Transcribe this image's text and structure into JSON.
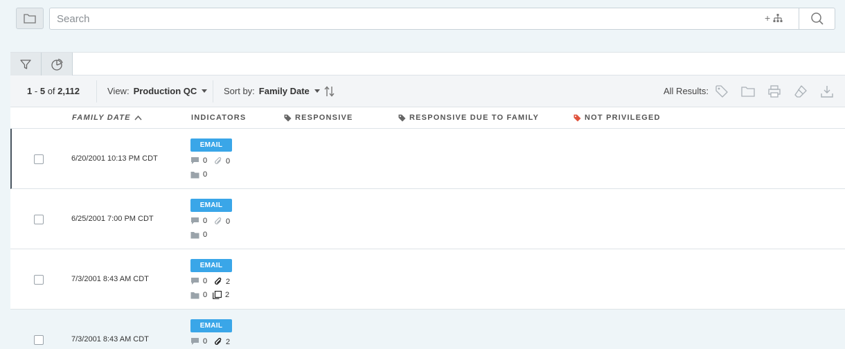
{
  "search": {
    "placeholder": "Search",
    "plus": "+"
  },
  "toolbar": {
    "range_start": "1",
    "range_sep": "-",
    "range_end": "5",
    "of_label": "of",
    "total": "2,112",
    "view_label": "View:",
    "view_value": "Production QC",
    "sort_label": "Sort by:",
    "sort_value": "Family Date",
    "all_results_label": "All Results:"
  },
  "columns": {
    "family_date": "Family Date",
    "indicators": "Indicators",
    "responsive": "Responsive",
    "responsive_family": "Responsive due to family",
    "not_privileged": "Not Privileged"
  },
  "colors": {
    "badge": "#3aa6e8",
    "tag_gray": "#666666",
    "tag_red": "#e0533d"
  },
  "rows": [
    {
      "date": "6/20/2001 10:13 PM CDT",
      "type": "EMAIL",
      "comments": "0",
      "attachments": "0",
      "folders": "0",
      "duplicates": ""
    },
    {
      "date": "6/25/2001 7:00 PM CDT",
      "type": "EMAIL",
      "comments": "0",
      "attachments": "0",
      "folders": "0",
      "duplicates": ""
    },
    {
      "date": "7/3/2001 8:43 AM CDT",
      "type": "EMAIL",
      "comments": "0",
      "attachments": "2",
      "folders": "0",
      "duplicates": "2"
    },
    {
      "date": "7/3/2001 8:43 AM CDT",
      "type": "EMAIL",
      "comments": "0",
      "attachments": "2",
      "folders": "",
      "duplicates": ""
    }
  ]
}
